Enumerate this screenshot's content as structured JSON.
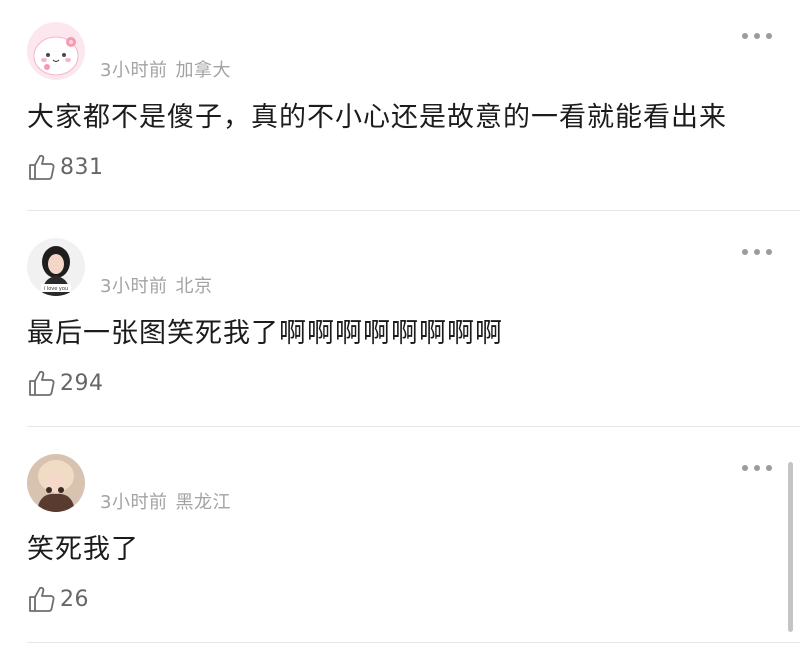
{
  "comments": [
    {
      "time": "3小时前",
      "location": "加拿大",
      "text": "大家都不是傻子，真的不小心还是故意的一看就能看出来",
      "likes": "831"
    },
    {
      "time": "3小时前",
      "location": "北京",
      "text": "最后一张图笑死我了啊啊啊啊啊啊啊啊",
      "likes": "294"
    },
    {
      "time": "3小时前",
      "location": "黑龙江",
      "text": "笑死我了",
      "likes": "26"
    }
  ],
  "icons": {
    "more": "more-icon",
    "like": "thumbs-up-icon"
  }
}
